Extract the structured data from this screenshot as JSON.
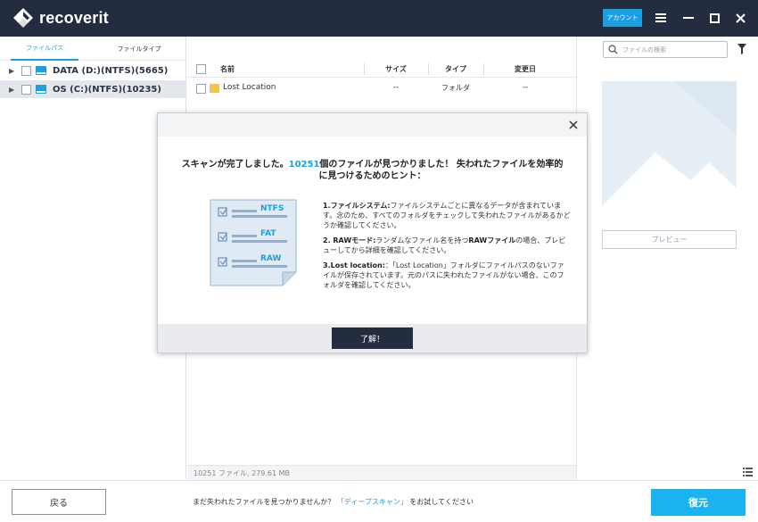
{
  "app": {
    "name": "recoverit"
  },
  "header": {
    "account_label": "アカウント"
  },
  "tabs": [
    {
      "label": "ファイルパス"
    },
    {
      "label": "ファイルタイプ"
    }
  ],
  "drives": [
    {
      "label": "DATA (D:)(NTFS)(5665)"
    },
    {
      "label": "OS (C:)(NTFS)(10235)"
    }
  ],
  "filelist": {
    "columns": {
      "name": "名前",
      "size": "サイズ",
      "type": "タイプ",
      "modified": "変更日"
    },
    "rows": [
      {
        "name": "Lost Location",
        "size": "--",
        "type": "フォルダ",
        "modified": "--"
      }
    ],
    "status": "10251 ファイル, 279.61  MB"
  },
  "search": {
    "placeholder": "ファイルの検索"
  },
  "preview": {
    "button_label": "プレビュー"
  },
  "bottom": {
    "back_label": "戻る",
    "hint_pre": "まだ失われたファイルを見つかりませんか？",
    "hint_link": "「ディープスキャン」",
    "hint_post": "をお試してください",
    "recover_label": "復元"
  },
  "modal": {
    "title_pre": "スキャンが完了しました。",
    "title_count": "10251",
    "title_post": "個のファイルが見つかりました！ 失われたファイルを効率的",
    "title_line2": "に見つけるためのヒント：",
    "illus_labels": [
      "NTFS",
      "FAT",
      "RAW"
    ],
    "tips": [
      {
        "head": "1.ファイルシステム:",
        "body": "ファイルシステムごとに異なるデータが含まれています。念のため、すべてのフォルダをチェックして失われたファイルがあるかどうか確認してください。"
      },
      {
        "head": "2. RAWモード:",
        "body_pre": "ランダムなファイル名を持つ",
        "body_bold": "RAWファイル",
        "body_post": "の場合、プレビューしてから詳細を確認してください。"
      },
      {
        "head": "3.Lost location:",
        "body": "：「Lost Location」フォルダにファイルパスのないファイルが保存されています。元のパスに失われたファイルがない場合、このフォルダを確認してください。"
      }
    ],
    "ok_label": "了解！"
  },
  "colors": {
    "accent": "#1b9fe0",
    "titlebar": "#232d3f",
    "recover": "#1bb2f0"
  }
}
